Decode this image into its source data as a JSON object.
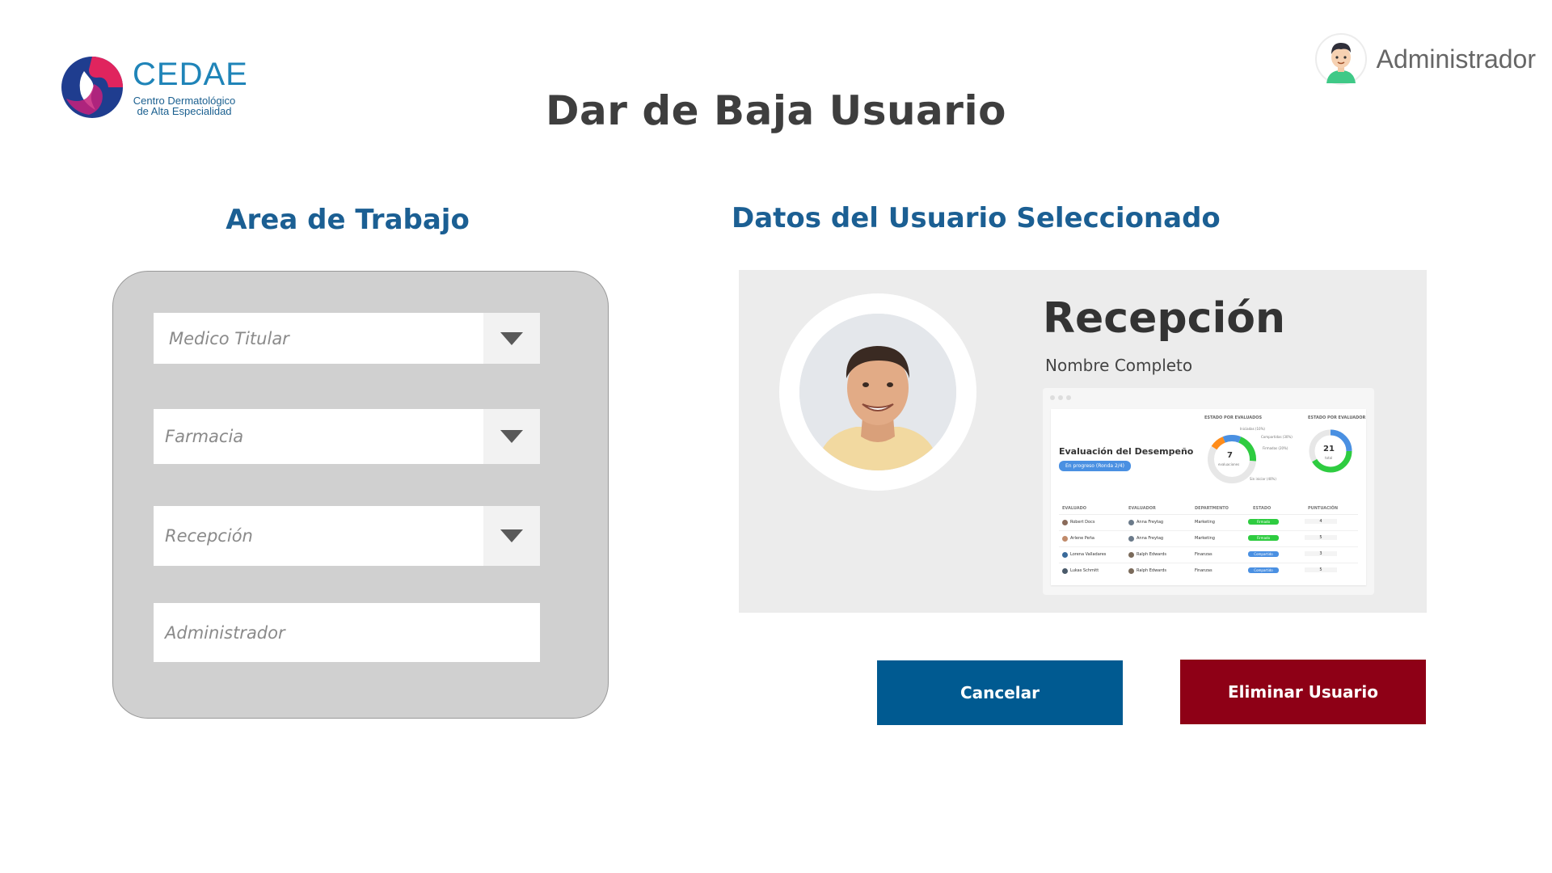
{
  "logo": {
    "name": "CEDAE",
    "subtitle_line1": "Centro Dermatológico",
    "subtitle_line2": "de Alta Especialidad"
  },
  "user": {
    "name": "Administrador",
    "icon": "user-avatar-icon"
  },
  "page": {
    "title": "Dar de Baja Usuario"
  },
  "area": {
    "title": "Area de Trabajo",
    "fields": [
      {
        "value": "Medico Titular",
        "has_dropdown": true
      },
      {
        "value": "Farmacia",
        "has_dropdown": true
      },
      {
        "value": "Recepción",
        "has_dropdown": true
      },
      {
        "value": "Administrador",
        "has_dropdown": false
      }
    ]
  },
  "datos": {
    "title": "Datos del Usuario Seleccionado",
    "role": "Recepción",
    "full_name_label": "Nombre Completo",
    "dashboard": {
      "title": "Evaluación del Desempeño",
      "badge": "En progreso (Ronda 2/4)",
      "chart1_header": "ESTADO POR EVALUADOS",
      "chart2_header": "ESTADO POR EVALUADOR",
      "chart1_value": "7",
      "chart1_label": "evaluaciones",
      "chart2_value": "21",
      "chart2_label": "total",
      "legend": [
        "Iniciadas (10%)",
        "Compartidas (30%)",
        "Firmadas (20%)",
        "Sin iniciar (40%)"
      ],
      "columns": [
        "EVALUADO",
        "EVALUADOR",
        "DEPARTMENTO",
        "ESTADO",
        "PUNTUACIÓN"
      ],
      "rows": [
        {
          "evaluado": "Robert Docs",
          "evaluador": "Anna Freytag",
          "depto": "Marketing",
          "estado": "Firmado",
          "puntuacion": "4"
        },
        {
          "evaluado": "Arlene Peña",
          "evaluador": "Anna Freytag",
          "depto": "Marketing",
          "estado": "Firmado",
          "puntuacion": "5"
        },
        {
          "evaluado": "Lorena Valladares",
          "evaluador": "Ralph Edwards",
          "depto": "Finanzas",
          "estado": "Compartido",
          "puntuacion": "3"
        },
        {
          "evaluado": "Lukas Schmitt",
          "evaluador": "Ralph Edwards",
          "depto": "Finanzas",
          "estado": "Compartido",
          "puntuacion": "5"
        }
      ]
    }
  },
  "buttons": {
    "cancel": "Cancelar",
    "delete": "Eliminar Usuario"
  },
  "colors": {
    "primary": "#005a91",
    "danger": "#8e0016",
    "heading": "#1b5f93",
    "brand_pink": "#e0245e",
    "brand_blue": "#1f3d8f"
  }
}
